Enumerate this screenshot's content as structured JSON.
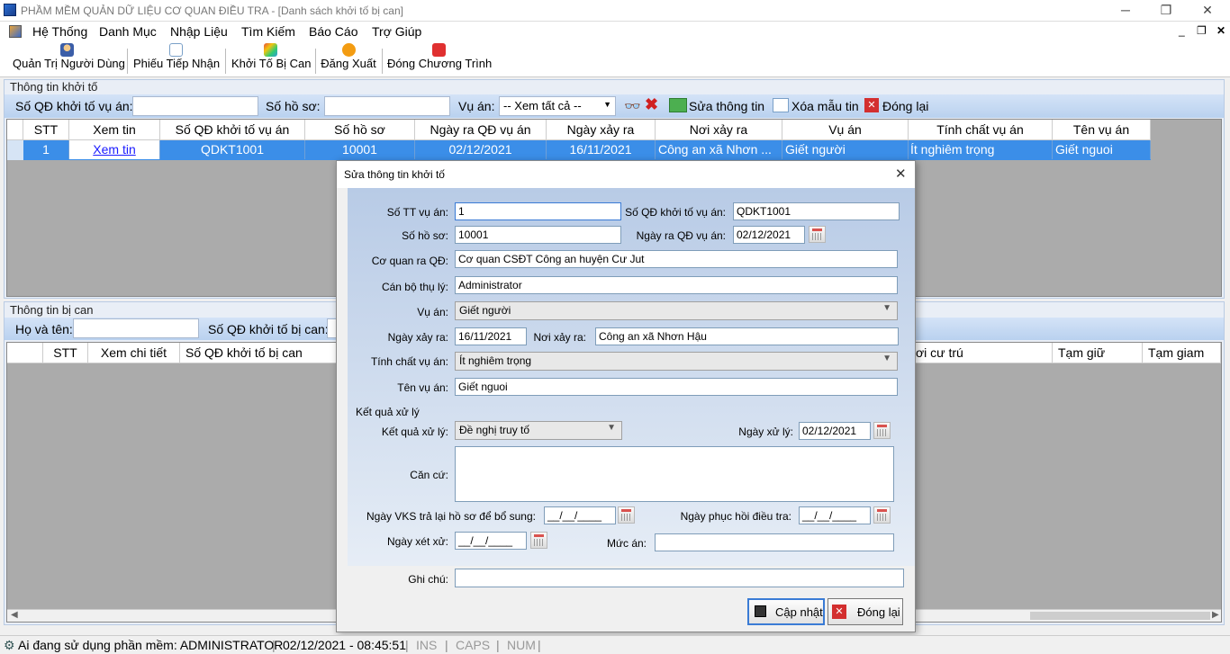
{
  "window": {
    "title": "PHẦM MỀM QUẢN DỮ LIỆU CƠ QUAN ĐIỀU TRA - [Danh sách khởi tố bị can]"
  },
  "menu": [
    "Hệ Thống",
    "Danh Mục",
    "Nhập Liệu",
    "Tìm Kiếm",
    "Báo Cáo",
    "Trợ Giúp"
  ],
  "toolbar": [
    "Quản Trị Người Dùng",
    "Phiếu Tiếp Nhận",
    "Khởi Tố Bị Can",
    "Đăng Xuất",
    "Đóng Chương Trình"
  ],
  "khoi_to": {
    "title": "Thông tin khởi tố",
    "so_qd_label": "Số QĐ khởi tố vụ án:",
    "so_ho_so_label": "Số hồ sơ:",
    "vu_an_label": "Vụ án:",
    "vu_an_value": "-- Xem tất cả --",
    "sua_label": "Sửa thông tin",
    "xoa_label": "Xóa mẫu tin",
    "dong_label": "Đóng lại",
    "columns": [
      "STT",
      "Xem tin",
      "Số QĐ khởi tố vụ án",
      "Số hồ sơ",
      "Ngày ra QĐ vụ án",
      "Ngày xảy ra",
      "Nơi xảy ra",
      "Vụ án",
      "Tính chất vụ án",
      "Tên vụ án"
    ],
    "row": [
      "1",
      "Xem tin",
      "QDKT1001",
      "10001",
      "02/12/2021",
      "16/11/2021",
      "Công an xã Nhơn ...",
      "Giết người",
      "Ít nghiêm trọng",
      "Giết nguoi"
    ]
  },
  "bi_can": {
    "title": "Thông tin bị can",
    "ho_ten_label": "Họ và tên:",
    "so_qd_label": "Số QĐ khởi tố bị can:",
    "columns": [
      "STT",
      "Xem chi tiết",
      "Số QĐ khởi tố bị can",
      "ơi cư trú",
      "Tạm giữ",
      "Tạm giam"
    ]
  },
  "dialog": {
    "title": "Sửa thông tin khởi tố",
    "so_tt_label": "Số TT vụ án:",
    "so_tt": "1",
    "so_qd_label": "Số QĐ khởi tố vụ án:",
    "so_qd": "QDKT1001",
    "so_ho_so_label": "Số hồ sơ:",
    "so_ho_so": "10001",
    "ngay_ra_qd_label": "Ngày ra QĐ vụ án:",
    "ngay_ra_qd": "02/12/2021",
    "co_quan_label": "Cơ quan ra QĐ:",
    "co_quan": "Cơ quan CSĐT Công an huyện Cư Jut",
    "can_bo_label": "Cán bộ thụ lý:",
    "can_bo": "Administrator",
    "vu_an_label": "Vụ án:",
    "vu_an": "Giết người",
    "ngay_xay_ra_label": "Ngày xảy ra:",
    "ngay_xay_ra": "16/11/2021",
    "noi_xay_ra_label": "Nơi xảy ra:",
    "noi_xay_ra": "Công an xã Nhơn Hậu",
    "tinh_chat_label": "Tính chất vụ án:",
    "tinh_chat": "Ít nghiêm trọng",
    "ten_vu_an_label": "Tên vụ án:",
    "ten_vu_an": "Giết nguoi",
    "ket_qua_group": "Kết quả xử lý",
    "ket_qua_label": "Kết quả xử lý:",
    "ket_qua": "Đề nghị truy tố",
    "ngay_xu_ly_label": "Ngày xử lý:",
    "ngay_xu_ly": "02/12/2021",
    "can_cu_label": "Căn cứ:",
    "ngay_vks_label": "Ngày VKS trả lại hồ sơ để bổ sung:",
    "ngay_vks": "__/__/____",
    "ngay_phuc_hoi_label": "Ngày phục hồi điều tra:",
    "ngay_phuc_hoi": "__/__/____",
    "ngay_xet_xu_label": "Ngày xét xử:",
    "ngay_xet_xu": "__/__/____",
    "muc_an_label": "Mức án:",
    "ghi_chu_label": "Ghi chú:",
    "cap_nhat": "Cập nhật",
    "dong_lai": "Đóng lại"
  },
  "status": {
    "user": "Ai đang sử dụng phần mềm: ADMINISTRATOR",
    "datetime": "02/12/2021 - 08:45:51",
    "ins": "INS",
    "caps": "CAPS",
    "num": "NUM"
  }
}
